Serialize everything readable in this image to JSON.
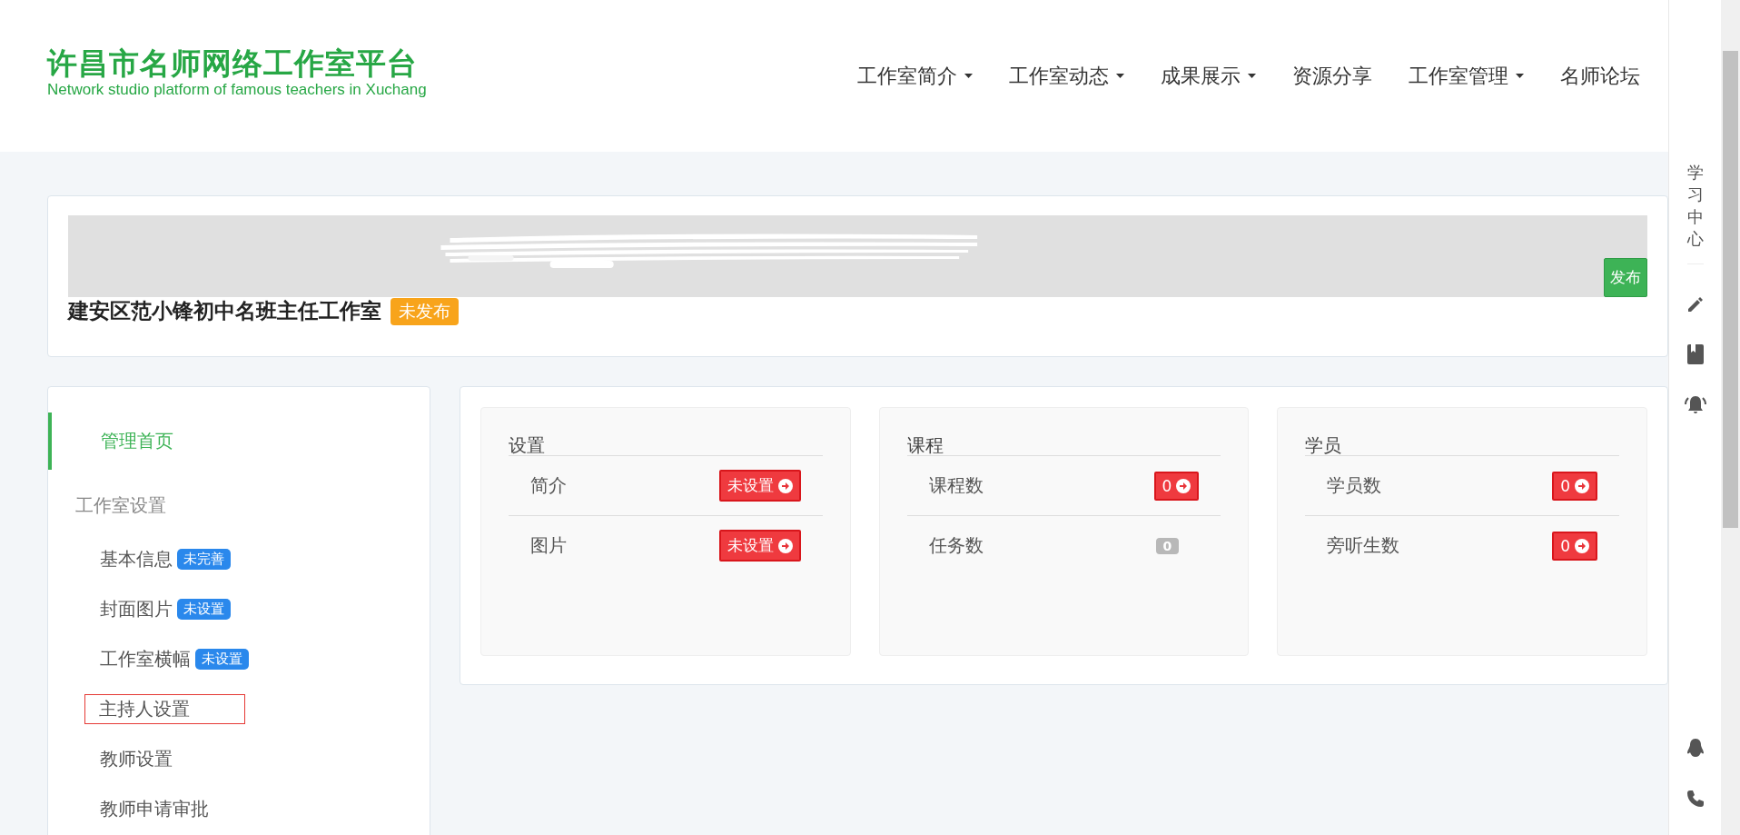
{
  "logo": {
    "title": "许昌市名师网络工作室平台",
    "subtitle": "Network studio platform of famous teachers in Xuchang"
  },
  "nav": [
    {
      "label": "工作室简介",
      "dropdown": true
    },
    {
      "label": "工作室动态",
      "dropdown": true
    },
    {
      "label": "成果展示",
      "dropdown": true
    },
    {
      "label": "资源分享",
      "dropdown": false
    },
    {
      "label": "工作室管理",
      "dropdown": true
    },
    {
      "label": "名师论坛",
      "dropdown": false
    }
  ],
  "studio": {
    "name": "建安区范小锋初中名班主任工作室",
    "status": "未发布",
    "publish_button": "发布"
  },
  "sidebar": {
    "items": [
      {
        "label": "管理首页",
        "selected": true
      }
    ],
    "groups": [
      {
        "title": "工作室设置",
        "children": [
          {
            "label": "基本信息",
            "badge": "未完善",
            "highlighted": false
          },
          {
            "label": "封面图片",
            "badge": "未设置",
            "highlighted": false
          },
          {
            "label": "工作室横幅",
            "badge": "未设置",
            "highlighted": false
          },
          {
            "label": "主持人设置",
            "highlighted": true
          },
          {
            "label": "教师设置",
            "highlighted": false
          },
          {
            "label": "教师申请审批",
            "highlighted": false
          }
        ]
      }
    ]
  },
  "panels": [
    {
      "title": "设置",
      "rows": [
        {
          "label": "简介",
          "value": "未设置",
          "kind": "action"
        },
        {
          "label": "图片",
          "value": "未设置",
          "kind": "action"
        }
      ]
    },
    {
      "title": "课程",
      "rows": [
        {
          "label": "课程数",
          "value": "0",
          "kind": "action"
        },
        {
          "label": "任务数",
          "value": "0",
          "kind": "muted"
        }
      ]
    },
    {
      "title": "学员",
      "rows": [
        {
          "label": "学员数",
          "value": "0",
          "kind": "action"
        },
        {
          "label": "旁听生数",
          "value": "0",
          "kind": "action"
        }
      ]
    }
  ],
  "right_rail": {
    "label": "学习中心"
  }
}
